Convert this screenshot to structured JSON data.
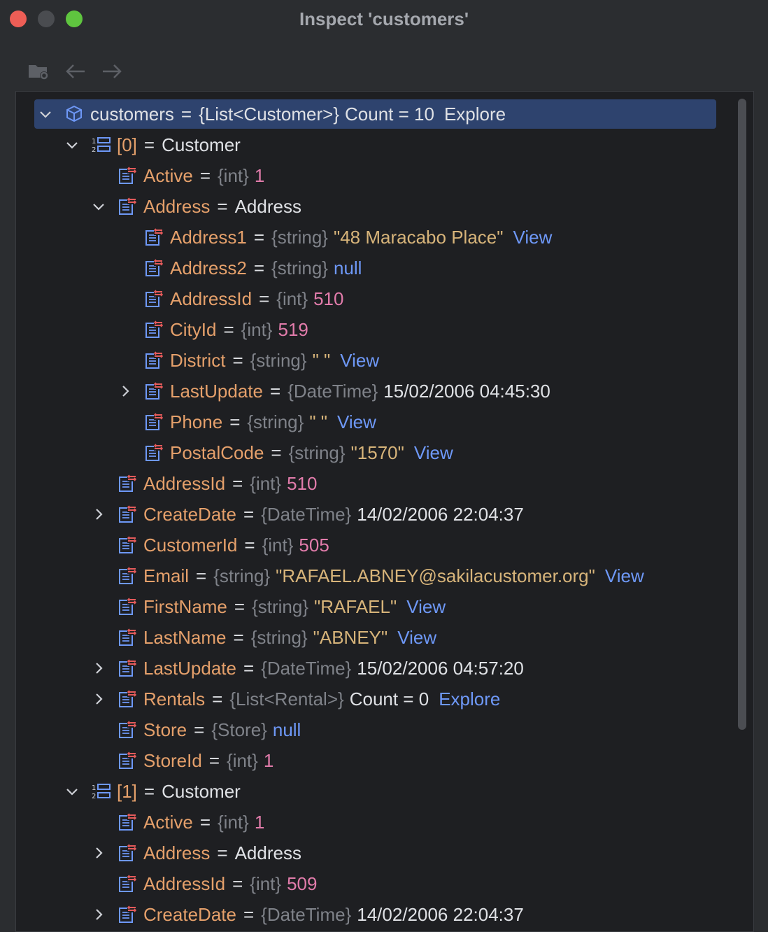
{
  "window": {
    "title": "Inspect 'customers'"
  },
  "root": {
    "name": "customers",
    "type": "{List<Customer>}",
    "value": "Count = 10",
    "action": "Explore"
  },
  "rows": [
    {
      "kind": "item",
      "index": "[0]",
      "value": "Customer"
    },
    {
      "name": "Active",
      "type": "{int}",
      "value": "1",
      "vclass": "num"
    },
    {
      "name": "Address",
      "type": "",
      "value": "Address",
      "vclass": "plain"
    },
    {
      "name": "Address1",
      "type": "{string}",
      "value": "\"48 Maracabo Place\"",
      "vclass": "str",
      "action": "View"
    },
    {
      "name": "Address2",
      "type": "{string}",
      "value": "null",
      "vclass": "kw"
    },
    {
      "name": "AddressId",
      "type": "{int}",
      "value": "510",
      "vclass": "num"
    },
    {
      "name": "CityId",
      "type": "{int}",
      "value": "519",
      "vclass": "num"
    },
    {
      "name": "District",
      "type": "{string}",
      "value": "\" \"",
      "vclass": "str",
      "action": "View"
    },
    {
      "name": "LastUpdate",
      "type": "{DateTime}",
      "value": "15/02/2006 04:45:30",
      "vclass": "plain"
    },
    {
      "name": "Phone",
      "type": "{string}",
      "value": "\" \"",
      "vclass": "str",
      "action": "View"
    },
    {
      "name": "PostalCode",
      "type": "{string}",
      "value": "\"1570\"",
      "vclass": "str",
      "action": "View"
    },
    {
      "name": "AddressId",
      "type": "{int}",
      "value": "510",
      "vclass": "num"
    },
    {
      "name": "CreateDate",
      "type": "{DateTime}",
      "value": "14/02/2006 22:04:37",
      "vclass": "plain"
    },
    {
      "name": "CustomerId",
      "type": "{int}",
      "value": "505",
      "vclass": "num"
    },
    {
      "name": "Email",
      "type": "{string}",
      "value": "\"RAFAEL.ABNEY@sakilacustomer.org\"",
      "vclass": "str",
      "action": "View"
    },
    {
      "name": "FirstName",
      "type": "{string}",
      "value": "\"RAFAEL\"",
      "vclass": "str",
      "action": "View"
    },
    {
      "name": "LastName",
      "type": "{string}",
      "value": "\"ABNEY\"",
      "vclass": "str",
      "action": "View"
    },
    {
      "name": "LastUpdate",
      "type": "{DateTime}",
      "value": "15/02/2006 04:57:20",
      "vclass": "plain"
    },
    {
      "name": "Rentals",
      "type": "{List<Rental>}",
      "value": "Count = 0",
      "vclass": "plain",
      "action": "Explore"
    },
    {
      "name": "Store",
      "type": "{Store}",
      "value": "null",
      "vclass": "kw"
    },
    {
      "name": "StoreId",
      "type": "{int}",
      "value": "1",
      "vclass": "num"
    },
    {
      "kind": "item",
      "index": "[1]",
      "value": "Customer"
    },
    {
      "name": "Active",
      "type": "{int}",
      "value": "1",
      "vclass": "num"
    },
    {
      "name": "Address",
      "type": "",
      "value": "Address",
      "vclass": "plain"
    },
    {
      "name": "AddressId",
      "type": "{int}",
      "value": "509",
      "vclass": "num"
    },
    {
      "name": "CreateDate",
      "type": "{DateTime}",
      "value": "14/02/2006 22:04:37",
      "vclass": "plain"
    }
  ],
  "equals": "=",
  "colors": {
    "selection": "#2e436e",
    "field": "#e5a06b",
    "number": "#e27cab",
    "string": "#d7b47a",
    "link": "#6e98f7"
  }
}
